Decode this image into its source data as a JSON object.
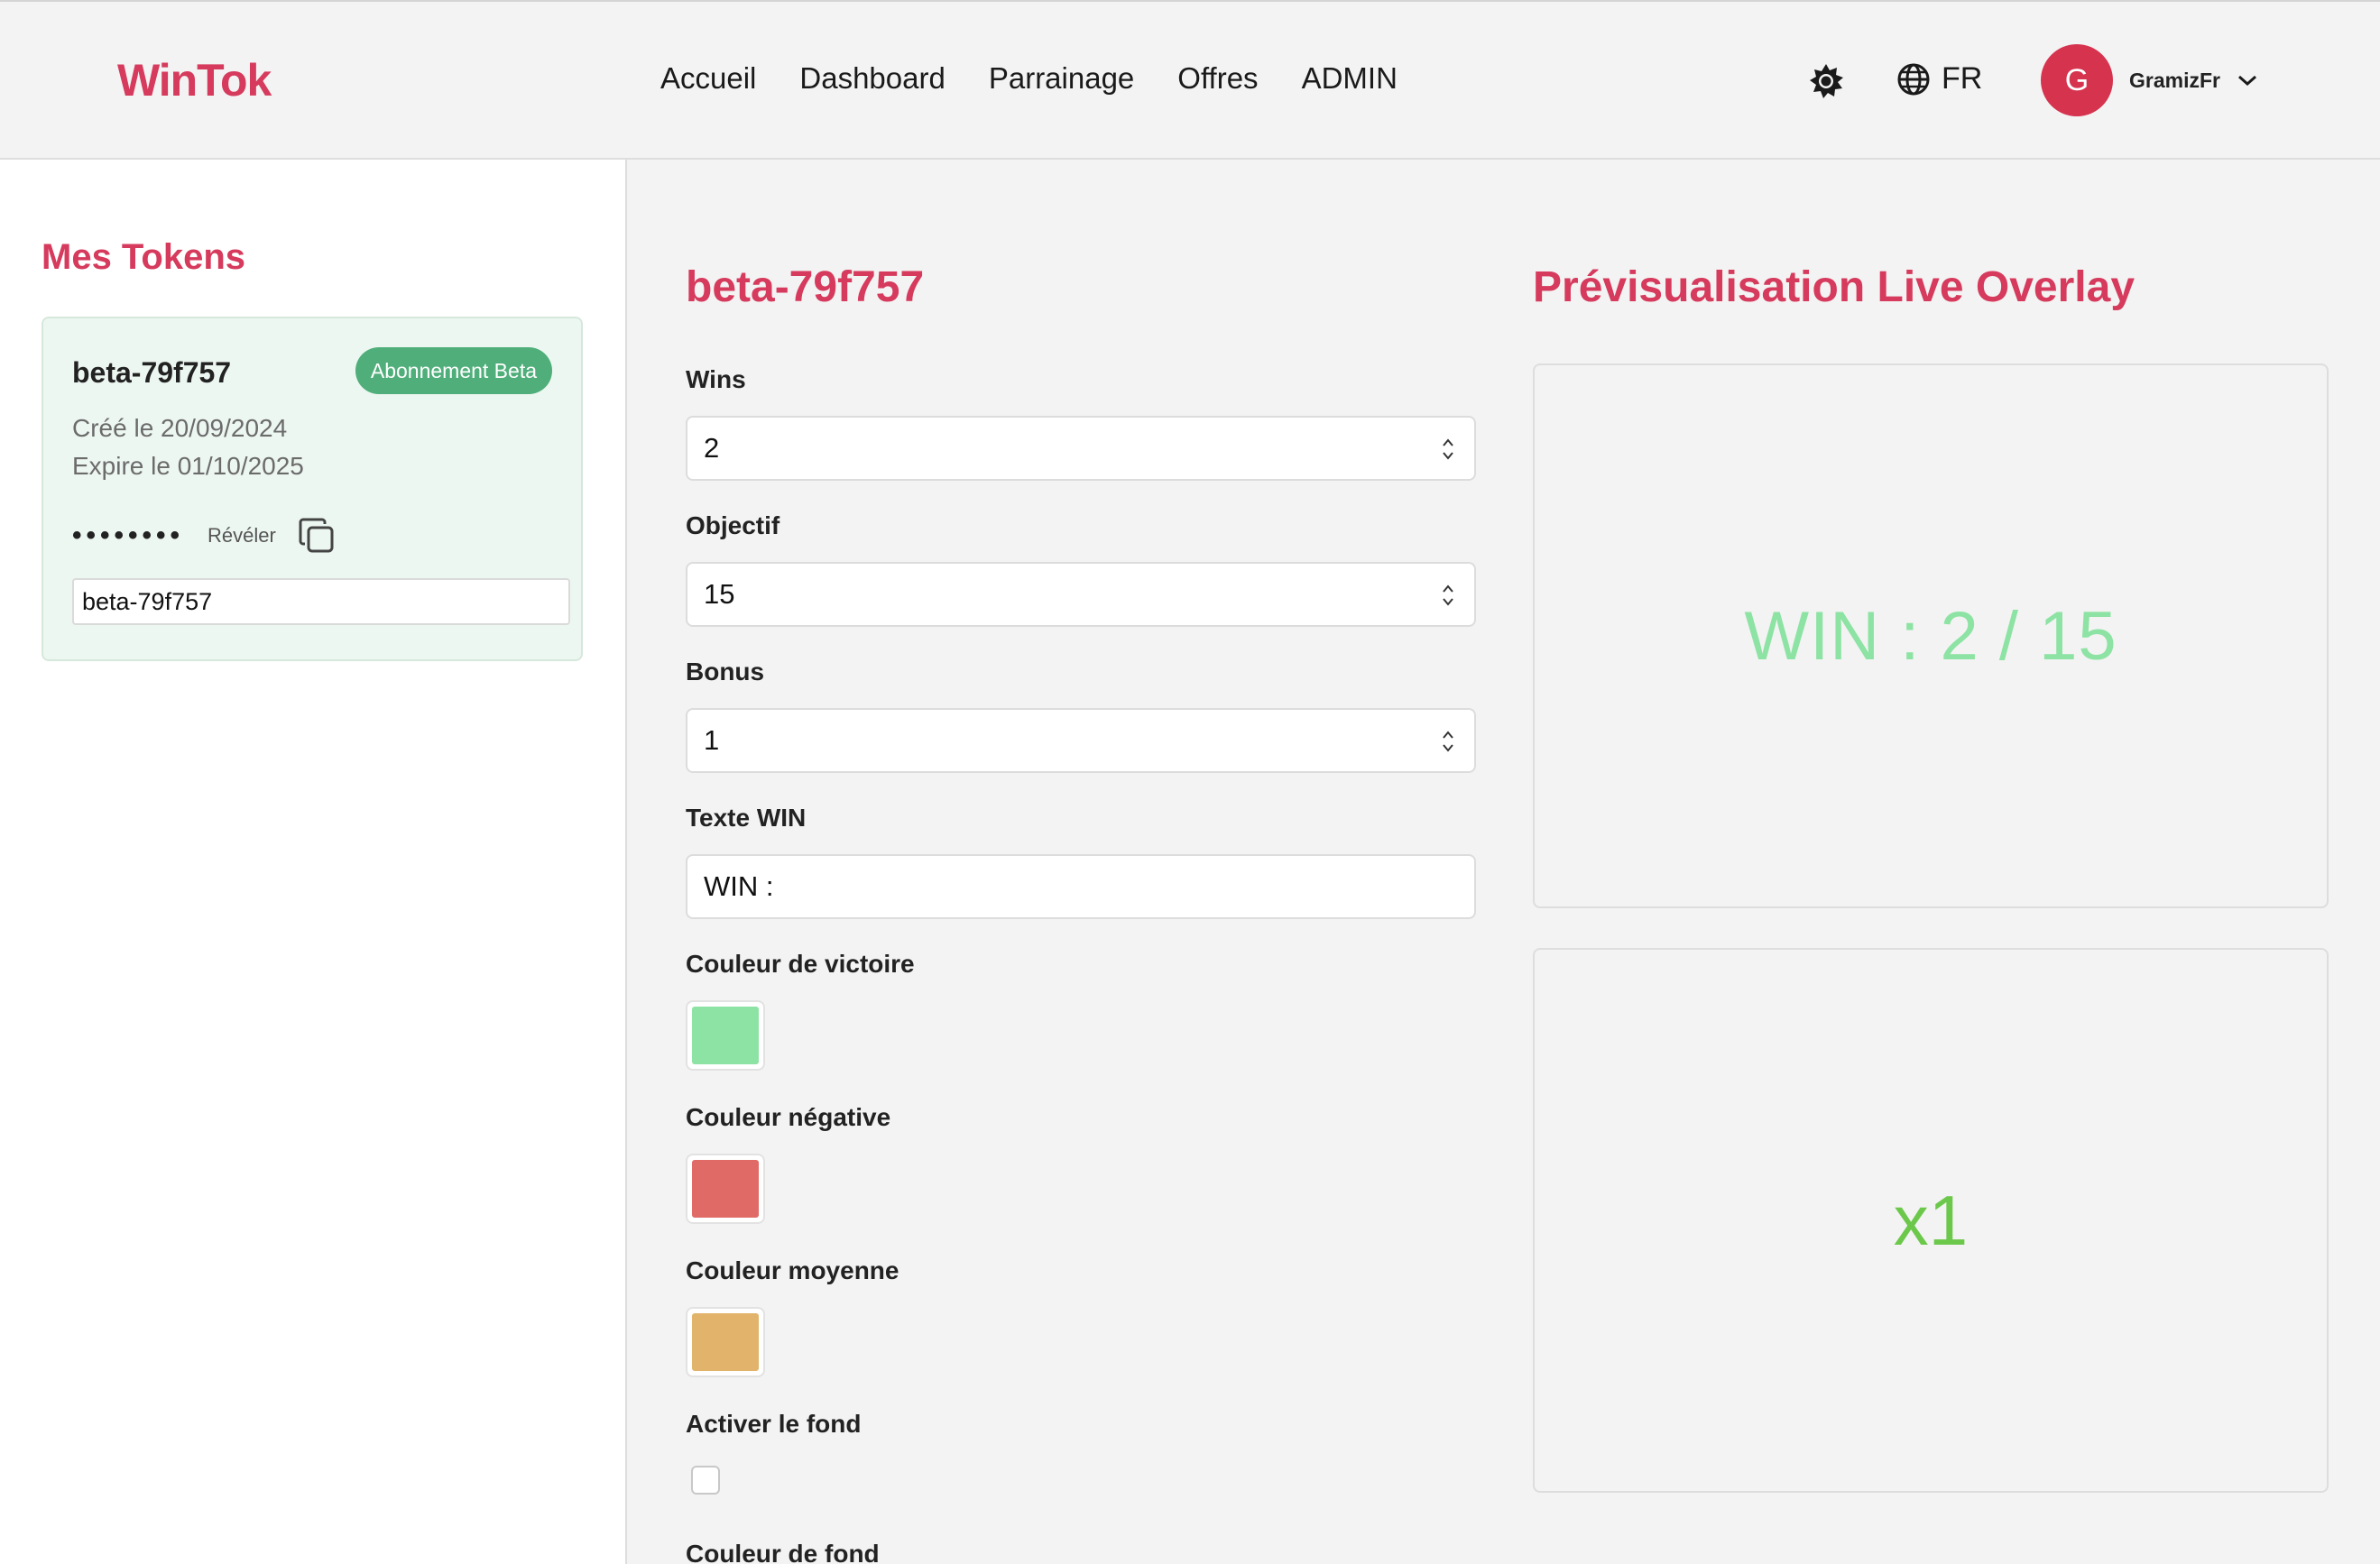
{
  "header": {
    "logo": "WinTok",
    "nav": [
      "Accueil",
      "Dashboard",
      "Parrainage",
      "Offres",
      "ADMIN"
    ],
    "theme_icon": "gear-sun-icon",
    "language": "FR",
    "language_icon": "globe-icon",
    "user": {
      "initial": "G",
      "name": "GramizFr"
    }
  },
  "sidebar": {
    "title": "Mes Tokens",
    "token": {
      "name": "beta-79f757",
      "badge": "Abonnement Beta",
      "created": "Créé le 20/09/2024",
      "expires": "Expire le 01/10/2025",
      "masked": "••••••••",
      "reveal_label": "Révéler",
      "input_value": "beta-79f757"
    }
  },
  "form": {
    "title": "beta-79f757",
    "fields": {
      "wins": {
        "label": "Wins",
        "value": "2"
      },
      "objectif": {
        "label": "Objectif",
        "value": "15"
      },
      "bonus": {
        "label": "Bonus",
        "value": "1"
      },
      "texte_win": {
        "label": "Texte WIN",
        "value": "WIN :"
      }
    },
    "colors": {
      "victoire": {
        "label": "Couleur de victoire",
        "hex": "#8de3a3"
      },
      "negative": {
        "label": "Couleur négative",
        "hex": "#df6a66"
      },
      "moyenne": {
        "label": "Couleur moyenne",
        "hex": "#e2b46b"
      }
    },
    "background": {
      "label": "Activer le fond",
      "checked": false
    },
    "background_color": {
      "label": "Couleur de fond"
    }
  },
  "preview": {
    "title": "Prévisualisation Live Overlay",
    "win_text": "WIN : 2 / 15",
    "multiplier": "x1"
  },
  "theme": {
    "accent": "#d63a5c",
    "badge_green": "#4fae7a"
  }
}
